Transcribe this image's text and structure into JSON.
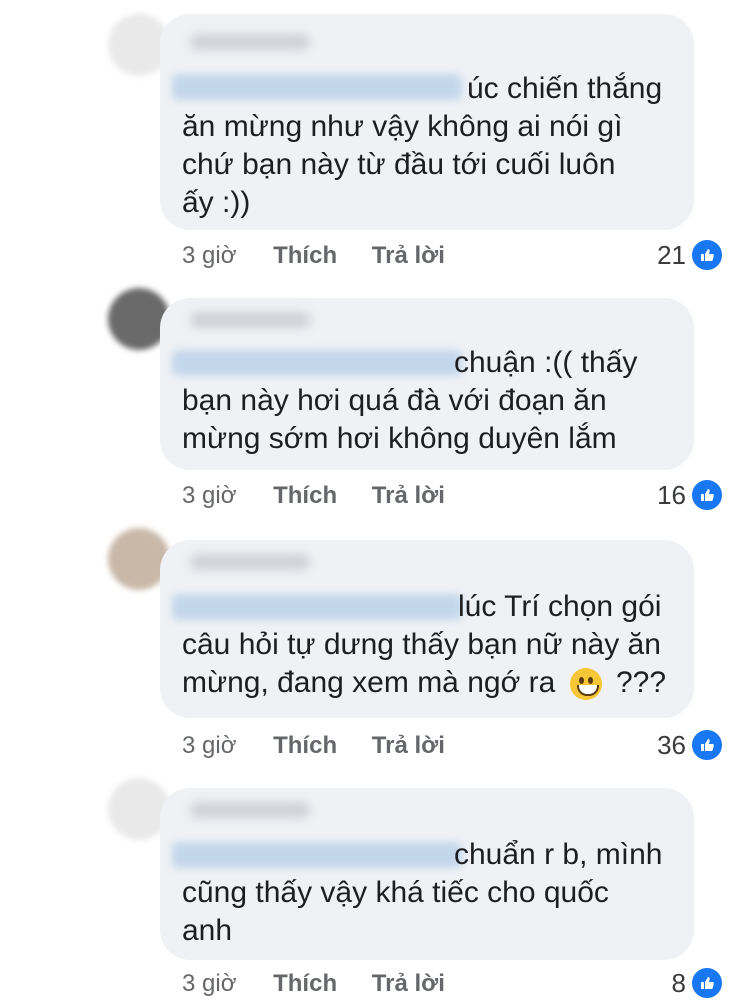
{
  "comments": [
    {
      "lines": [
        "úc chiến thắng",
        "ăn mừng như vậy không ai nói gì",
        "chứ bạn này từ đầu tới cuối luôn",
        "ấy :))"
      ],
      "time": "3 giờ",
      "like_label": "Thích",
      "reply_label": "Trả lời",
      "reactions": "21"
    },
    {
      "lines": [
        "chuận :(( thấy",
        "bạn này hơi quá đà với đoạn ăn",
        "mừng sớm hơi không duyên lắm"
      ],
      "time": "3 giờ",
      "like_label": "Thích",
      "reply_label": "Trả lời",
      "reactions": "16"
    },
    {
      "lines": [
        "lúc Trí chọn gói",
        "câu hỏi tự dưng thấy bạn nữ này ăn",
        "mừng, đang xem mà ngớ ra",
        "???"
      ],
      "time": "3 giờ",
      "like_label": "Thích",
      "reply_label": "Trả lời",
      "reactions": "36"
    },
    {
      "lines": [
        "chuẩn r b, mình",
        "cũng thấy vậy khá tiếc cho quốc",
        "anh"
      ],
      "time": "3 giờ",
      "like_label": "Thích",
      "reply_label": "Trả lời",
      "reactions": "8"
    }
  ],
  "colors": {
    "bubble": "#eff1f4",
    "like_blue": "#1877f2",
    "meta_text": "#65676b"
  },
  "icons": {
    "reaction": "thumbs-up-icon",
    "emoji": "grinning-face-icon"
  }
}
